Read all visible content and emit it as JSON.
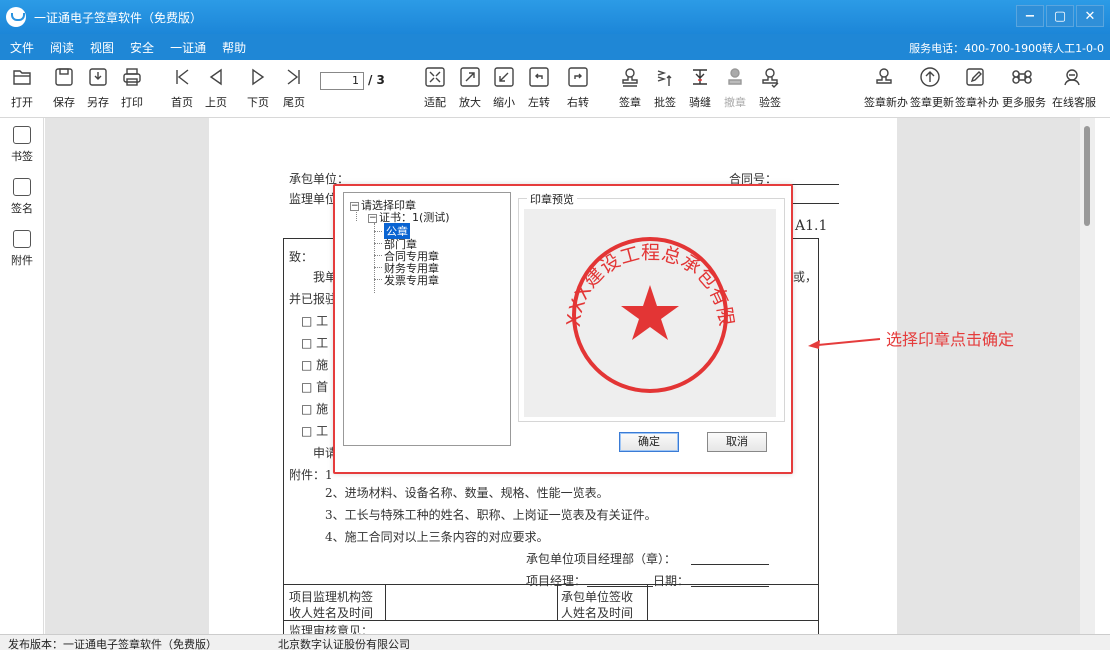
{
  "app": {
    "title": "一证通电子签章软件（免费版）",
    "window_buttons": [
      "−",
      "▢",
      "✕"
    ]
  },
  "menu": {
    "items": [
      "文件",
      "阅读",
      "视图",
      "安全",
      "一证通",
      "帮助"
    ],
    "service": "服务电话：400-700-1900转人工1-0-0"
  },
  "toolbar": {
    "open": "打开",
    "save": "保存",
    "save_as": "另存",
    "print": "打印",
    "first": "首页",
    "prev": "上页",
    "next": "下页",
    "last": "尾页",
    "page_current": "1",
    "page_total": "/ 3",
    "fit": "适配",
    "zoom_in": "放大",
    "zoom_out": "缩小",
    "rotate_left": "左转",
    "rotate_right": "右转",
    "sign": "签章",
    "batch_sign": "批签",
    "seam_sign": "骑缝",
    "revoke": "撤章",
    "verify": "验签",
    "new_cert": "签章新办",
    "update_cert": "签章更新",
    "reissue_cert": "签章补办",
    "more": "更多服务",
    "support": "在线客服"
  },
  "sidebar": {
    "bookmark": "书签",
    "signature": "签名",
    "attachment": "附件"
  },
  "document": {
    "contractor": "承包单位：",
    "contract_no": "合同号：",
    "supervisor": "监理单位",
    "code": "A1.1",
    "to": "致：",
    "body_start": "我单",
    "comma": "或，",
    "body2": "并已报驻",
    "checkboxes": [
      "□ 工",
      "□ 工",
      "□ 施",
      "□ 首",
      "□ 施",
      "□ 工"
    ],
    "apply": "申请",
    "attach": "附件：1",
    "attach_2": "2、进场材料、设备名称、数量、规格、性能一览表。",
    "attach_3": "3、工长与特殊工种的姓名、职称、上岗证一览表及有关证件。",
    "attach_4": "4、施工合同对以上三条内容的对应要求。",
    "pm_dept": "承包单位项目经理部（章）：",
    "pm": "项目经理：",
    "date": "日期：",
    "sup_sign": "项目监理机构签",
    "sup_sign2": "收人姓名及时间",
    "con_sign": "承包单位签收",
    "con_sign2": "人姓名及时间",
    "review": "监理审核意见："
  },
  "dialog": {
    "tree_root": "请选择印章",
    "cert": "证书：1(测试)",
    "seals": [
      "公章",
      "部门章",
      "合同专用章",
      "财务专用章",
      "发票专用章"
    ],
    "selected_seal": "公章",
    "preview_label": "印章预览",
    "seal_text": "北京XXX建设工程总承包有限公司",
    "ok": "确定",
    "cancel": "取消"
  },
  "annotation": {
    "text": "选择印章点击确定"
  },
  "status": {
    "version": "发布版本：一证通电子签章软件（免费版）",
    "company": "北京数字认证股份有限公司"
  },
  "colors": {
    "titlebar": "#1c86d8",
    "menubar": "#1f87d6",
    "highlight": "#e53c3c",
    "selection": "#0a64d2",
    "seal": "#e33535"
  }
}
